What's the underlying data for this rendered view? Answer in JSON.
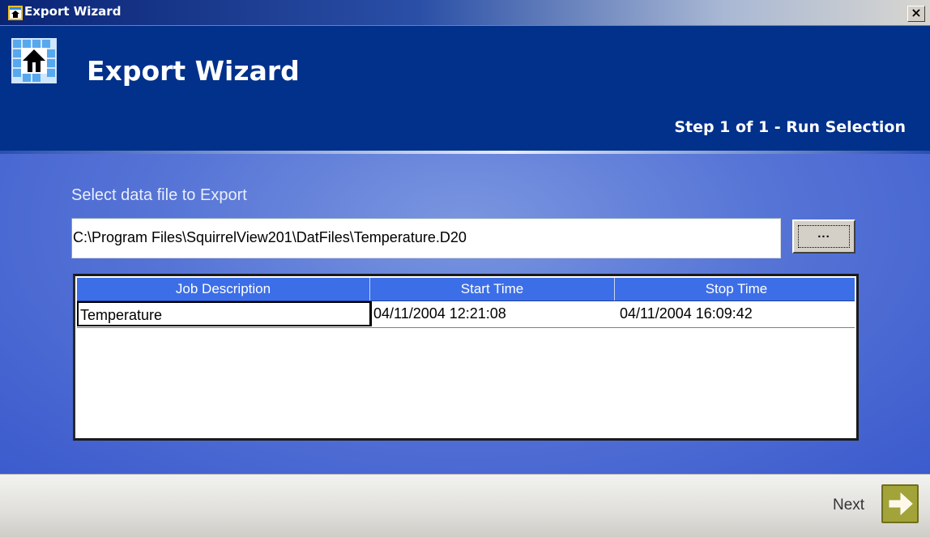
{
  "window": {
    "title": "Export Wizard",
    "close_glyph": "×"
  },
  "header": {
    "title": "Export Wizard",
    "step": "Step 1 of 1 - Run Selection"
  },
  "main": {
    "select_label": "Select data file to Export",
    "file_path": "C:\\Program Files\\SquirrelView201\\DatFiles\\Temperature.D20",
    "browse_label": "...",
    "columns": [
      "Job Description",
      "Start Time",
      "Stop Time"
    ],
    "rows": [
      {
        "job": "Temperature",
        "start": "04/11/2004 12:21:08",
        "stop": "04/11/2004 16:09:42"
      }
    ]
  },
  "footer": {
    "next_label": "Next"
  },
  "icons": {
    "app": "export-wizard-icon",
    "next": "arrow-right-icon"
  }
}
